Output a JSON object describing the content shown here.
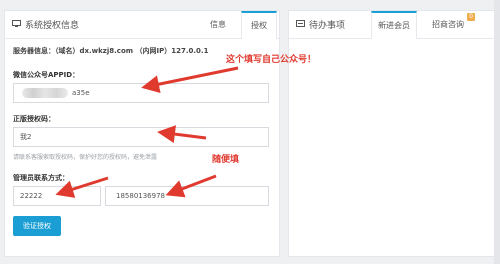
{
  "left": {
    "title": "系统授权信息",
    "tabs": [
      "信息",
      "授权"
    ],
    "server_info": "服务器信息：（域名）dx.wkzj8.com （内网IP）127.0.0.1",
    "appid_label": "微信公众号APPID：",
    "appid_value": "a35e",
    "auth_code_label": "正版授权码：",
    "auth_code_value": "我2",
    "hint": "请联系客服索取授权码，保护好您的授权码，避免泄露",
    "contact_label": "管理员联系方式：",
    "qq_value": "22222",
    "phone_value": "18580136978",
    "verify_button": "验证授权"
  },
  "right": {
    "title": "待办事项",
    "tabs": [
      "新进会员",
      "招商咨询"
    ],
    "badge": "0"
  },
  "annotations": {
    "appid_note": "这个填写自己公众号！",
    "random_note": "随便填"
  },
  "colors": {
    "accent": "#1a9ed4",
    "annotation": "#e03a2f",
    "badge": "#f0ad4e"
  }
}
